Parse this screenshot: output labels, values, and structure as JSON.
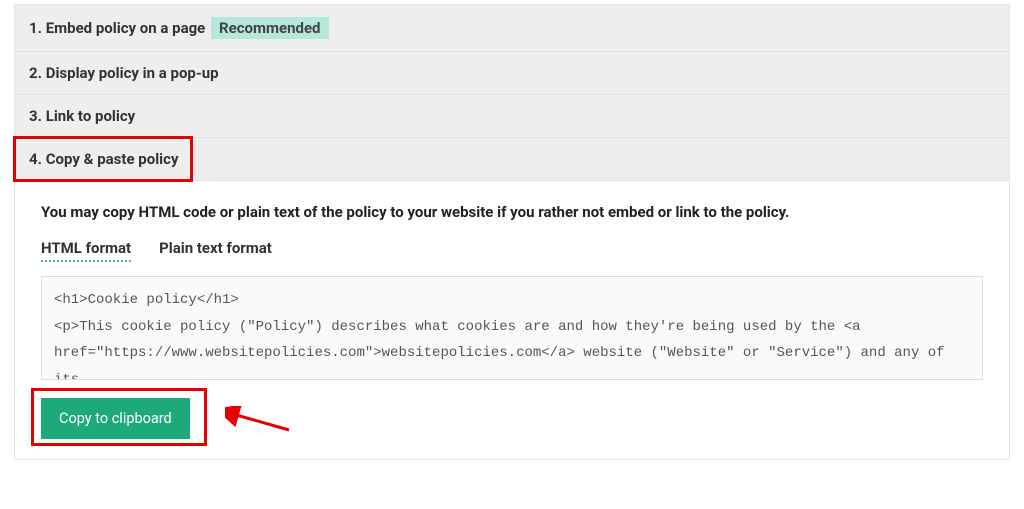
{
  "accordion": {
    "items": [
      {
        "num": "1.",
        "label": "Embed policy on a page",
        "badge": "Recommended"
      },
      {
        "num": "2.",
        "label": "Display policy in a pop-up"
      },
      {
        "num": "3.",
        "label": "Link to policy"
      },
      {
        "num": "4.",
        "label": "Copy & paste policy"
      }
    ]
  },
  "panel": {
    "description": "You may copy HTML code or plain text of the policy to your website if you rather not embed or link to the policy.",
    "tabs": {
      "html": "HTML format",
      "plain": "Plain text format"
    },
    "code": "<h1>Cookie policy</h1>\n<p>This cookie policy (\"Policy\") describes what cookies are and how they're being used by the <a href=\"https://www.websitepolicies.com\">websitepolicies.com</a> website (\"Website\" or \"Service\") and any of its",
    "copy_button": "Copy to clipboard"
  }
}
